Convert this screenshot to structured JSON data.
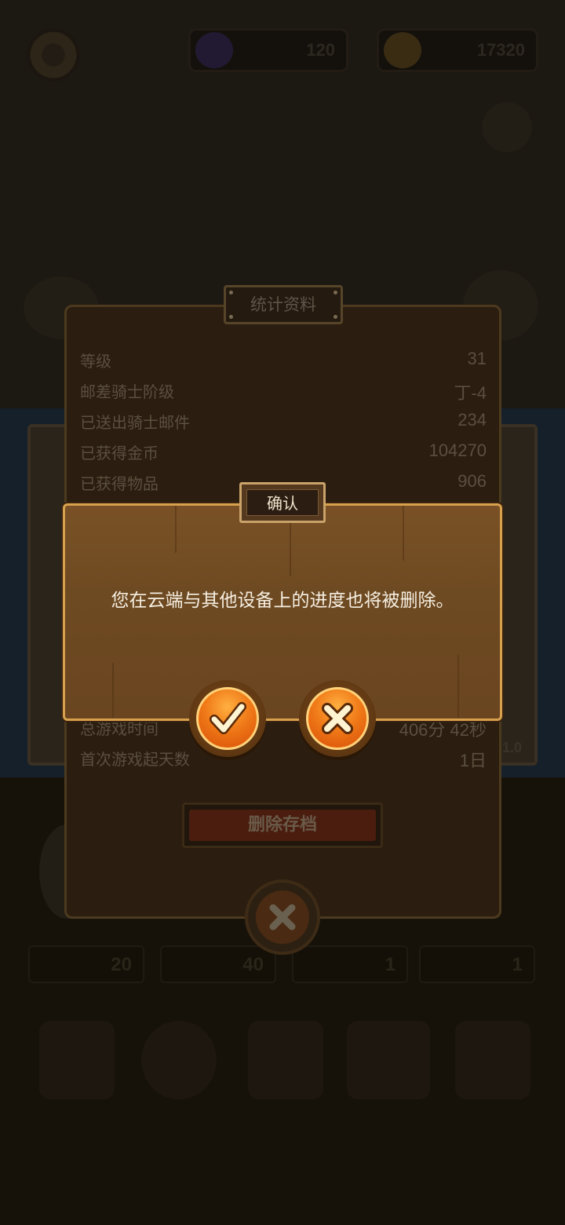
{
  "hud": {
    "gems": "120",
    "coins": "17320"
  },
  "stats_panel": {
    "title": "统计资料",
    "rows": [
      {
        "label": "等级",
        "value": "31"
      },
      {
        "label": "邮差骑士阶级",
        "value": "丁-4"
      },
      {
        "label": "已送出骑士邮件",
        "value": "234"
      },
      {
        "label": "已获得金币",
        "value": "104270"
      },
      {
        "label": "已获得物品",
        "value": "906"
      }
    ],
    "play_time_label": "总游戏时间",
    "play_time_value": "406分 42秒",
    "first_day_label": "首次游戏起天数",
    "first_day_value": "1日",
    "delete_button": "删除存档"
  },
  "confirm_dialog": {
    "title": "确认",
    "message": "您在云端与其他设备上的进度也将被删除。"
  },
  "background": {
    "version": "1.0",
    "slots": [
      "20",
      "40",
      "1",
      "1"
    ]
  },
  "colors": {
    "accent_orange": "#f07a18",
    "dialog_wood": "#6e4a22",
    "dialog_border": "#d8a14e"
  }
}
